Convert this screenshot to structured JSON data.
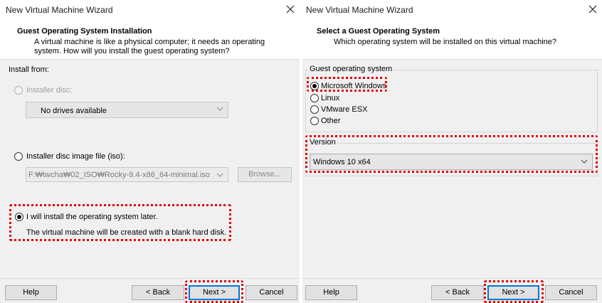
{
  "left": {
    "window_title": "New Virtual Machine Wizard",
    "header_title": "Guest Operating System Installation",
    "header_desc": "A virtual machine is like a physical computer; it needs an operating system. How will you install the guest operating system?",
    "install_from_label": "Install from:",
    "installer_disc_label": "Installer disc:",
    "drives_value": "No drives available",
    "iso_label": "Installer disc image file (iso):",
    "iso_path": "F:₩twcha₩02_ISO₩Rocky-9.4-x86_64-minimal.iso",
    "browse_label": "Browse...",
    "later_label": "I will install the operating system later.",
    "later_desc": "The virtual machine will be created with a blank hard disk.",
    "buttons": {
      "help": "Help",
      "back": "< Back",
      "next": "Next >",
      "cancel": "Cancel"
    }
  },
  "right": {
    "window_title": "New Virtual Machine Wizard",
    "header_title": "Select a Guest Operating System",
    "header_desc": "Which operating system will be installed on this virtual machine?",
    "group_label": "Guest operating system",
    "os_options": [
      "Microsoft Windows",
      "Linux",
      "VMware ESX",
      "Other"
    ],
    "selected_os": "Microsoft Windows",
    "version_label": "Version",
    "version_value": "Windows 10 x64",
    "buttons": {
      "help": "Help",
      "back": "< Back",
      "next": "Next >",
      "cancel": "Cancel"
    }
  },
  "colors": {
    "highlight": "#e00000",
    "panel_bg": "#f0f0f0",
    "default_button": "#0078d7"
  },
  "icons": [
    "close-icon",
    "chevron-down-icon"
  ]
}
